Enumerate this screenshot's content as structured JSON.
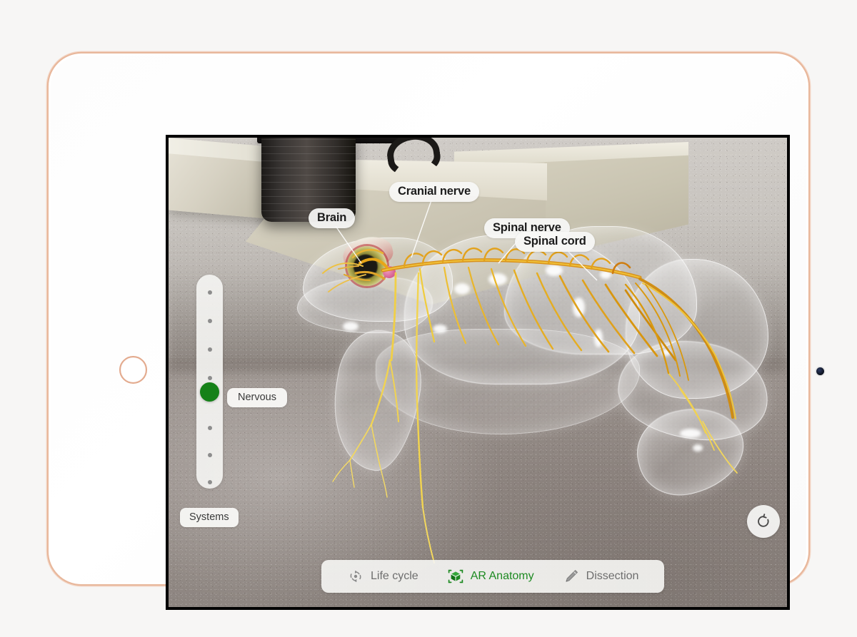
{
  "device": {
    "name": "tablet",
    "body_color": "#ffffff",
    "edge_color": "#e8b79b",
    "home_button": "home-button",
    "front_camera": "front-camera"
  },
  "app": {
    "mode": "AR Anatomy",
    "subject": "frog",
    "scene_description": "Augmented-reality translucent frog model with nervous system overlaid on a laboratory bench"
  },
  "annotations": [
    {
      "id": "brain",
      "label": "Brain"
    },
    {
      "id": "cranial-nerve",
      "label": "Cranial nerve"
    },
    {
      "id": "spinal-nerve",
      "label": "Spinal nerve"
    },
    {
      "id": "spinal-cord",
      "label": "Spinal cord"
    }
  ],
  "systems_slider": {
    "group_label": "Systems",
    "selected_label": "Nervous",
    "selected_index": 4,
    "total_positions": 8,
    "thumb_color": "#158118",
    "dot_color": "#8d8d8d"
  },
  "reset_button": {
    "icon": "reset-rotate-icon",
    "tooltip": "Reset"
  },
  "toolbar": {
    "items": [
      {
        "id": "life-cycle",
        "label": "Life cycle",
        "icon": "life-cycle-icon",
        "active": false
      },
      {
        "id": "ar-anatomy",
        "label": "AR Anatomy",
        "icon": "ar-cube-icon",
        "active": true
      },
      {
        "id": "dissection",
        "label": "Dissection",
        "icon": "pencil-icon",
        "active": false
      }
    ],
    "active_color": "#1d8a22",
    "inactive_color": "#6e6e6e"
  },
  "colors": {
    "page_background": "#f7f6f5",
    "screen_border": "#000000",
    "nerve_primary": "#e8a617",
    "nerve_secondary": "#f2d64a",
    "accent_green": "#158118"
  }
}
